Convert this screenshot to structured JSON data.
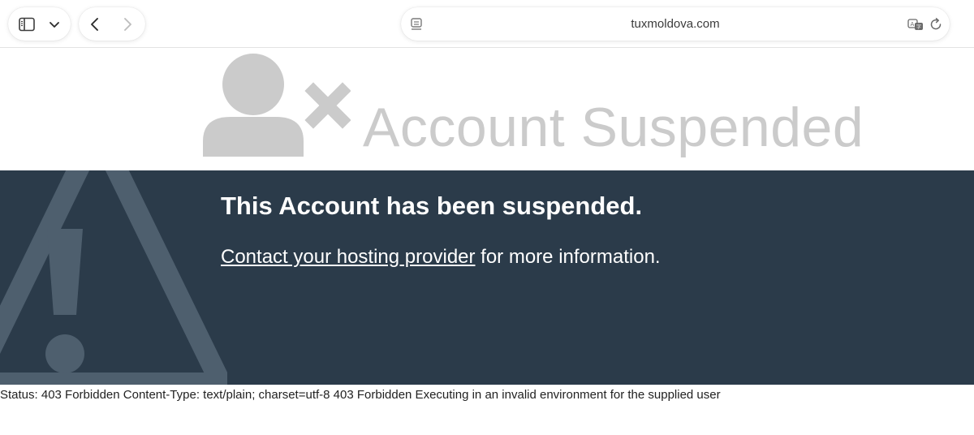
{
  "browser": {
    "address": "tuxmoldova.com",
    "toolbar_icons": [
      "sidebar-icon",
      "chevron-down-icon",
      "back-arrow-icon",
      "forward-arrow-icon",
      "reader-icon",
      "translate-icon",
      "reload-icon"
    ]
  },
  "page": {
    "hero_title": "Account Suspended",
    "hero_icon": "user-x-icon",
    "banner_icon": "warning-triangle-icon",
    "headline": "This Account has been suspended.",
    "contact_link": "Contact your hosting provider",
    "contact_suffix": " for more information.",
    "status_text": "Status: 403 Forbidden Content-Type: text/plain; charset=utf-8 403 Forbidden Executing in an invalid environment for the supplied user"
  },
  "colors": {
    "banner_bg": "#2b3b4a",
    "hero_gray": "#cbcbcb",
    "warning_gray": "#4e5f6e"
  }
}
